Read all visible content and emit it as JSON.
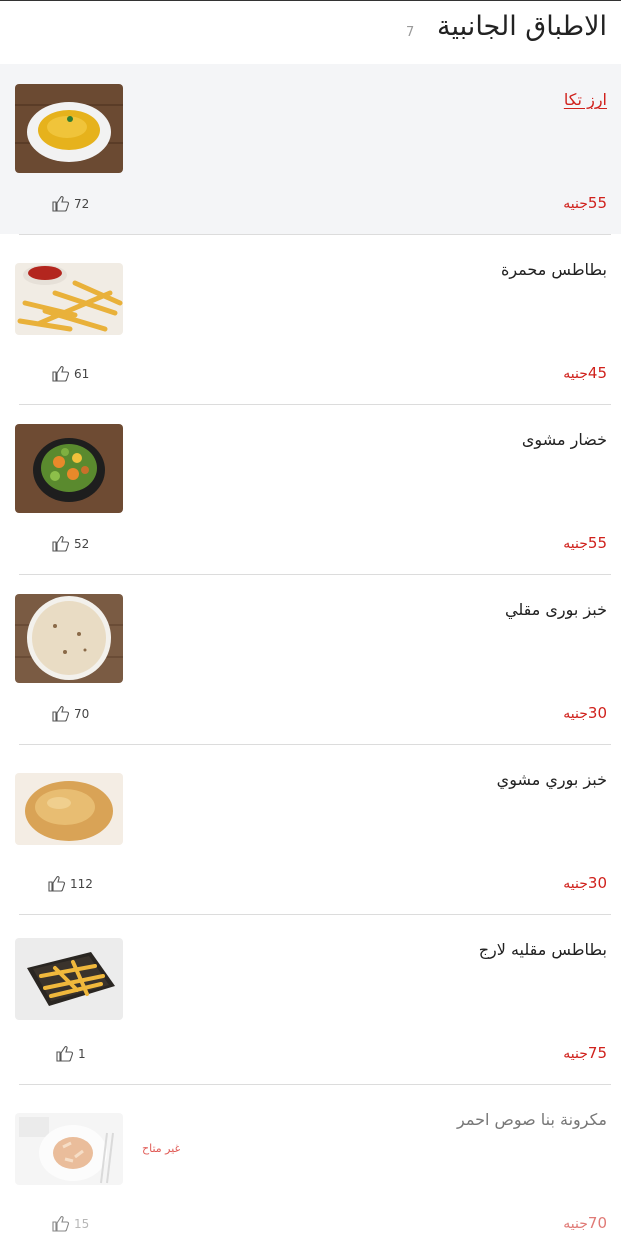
{
  "header": {
    "title": "الاطباق الجانبية",
    "count": "7"
  },
  "currency": "جنيه",
  "colors": {
    "accent": "#d0211c",
    "highlight_bg": "#f4f5f7",
    "unavailable": "#e05a55"
  },
  "items": [
    {
      "name": "ارز تكا",
      "price": "55",
      "likes": "72",
      "image": "yellow-rice-plate-icon"
    },
    {
      "name": "بطاطس محمرة",
      "price": "45",
      "likes": "61",
      "image": "french-fries-ketchup-icon"
    },
    {
      "name": "خضار مشوى",
      "price": "55",
      "likes": "52",
      "image": "grilled-vegetables-bowl-icon"
    },
    {
      "name": "خبز بورى مقلي",
      "price": "30",
      "likes": "70",
      "image": "fried-flatbread-icon"
    },
    {
      "name": "خبز بوري مشوي",
      "price": "30",
      "likes": "112",
      "image": "puffed-bread-icon"
    },
    {
      "name": "بطاطس مقليه لارج",
      "price": "75",
      "likes": "1",
      "image": "fries-tray-icon"
    },
    {
      "name": "مكرونة بنا صوص احمر",
      "price": "70",
      "likes": "15",
      "image": "penne-pasta-bowl-icon",
      "status": "غير متاح"
    }
  ]
}
